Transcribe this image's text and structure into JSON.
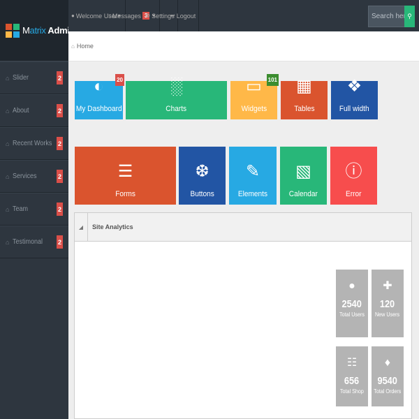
{
  "logo": {
    "part1": "M",
    "part2": "atrix",
    "part3": " Admin"
  },
  "sidebar": {
    "items": [
      {
        "label": "Slider",
        "badge": "2"
      },
      {
        "label": "About",
        "badge": "2"
      },
      {
        "label": "Recent Works",
        "badge": "2"
      },
      {
        "label": "Services",
        "badge": "2"
      },
      {
        "label": "Team",
        "badge": "2"
      },
      {
        "label": "Testimonal",
        "badge": "2"
      }
    ]
  },
  "topbar": {
    "welcome": "Welcome User",
    "messages": "Messages",
    "messages_count": "3",
    "settings": "Settings",
    "logout": "Logout",
    "search_placeholder": "Search here..."
  },
  "breadcrumb": {
    "home": "Home"
  },
  "tiles": [
    {
      "label": "My Dashboard",
      "icon": "dashboard-icon",
      "color": "#27a9e3",
      "badge": "20",
      "badge_color": "#da4f49"
    },
    {
      "label": "Charts",
      "icon": "bar-chart-icon",
      "color": "#28b779"
    },
    {
      "label": "Widgets",
      "icon": "inbox-icon",
      "color": "#ffb848",
      "badge": "101",
      "badge_color": "#3c8d2f"
    },
    {
      "label": "Tables",
      "icon": "table-icon",
      "color": "#da542e"
    },
    {
      "label": "Full width",
      "icon": "fullscreen-icon",
      "color": "#2255a4"
    },
    {
      "label": "Forms",
      "icon": "list-icon",
      "color": "#da542e"
    },
    {
      "label": "Buttons",
      "icon": "tint-icon",
      "color": "#2255a4"
    },
    {
      "label": "Elements",
      "icon": "pencil-icon",
      "color": "#27a9e3"
    },
    {
      "label": "Calendar",
      "icon": "calendar-icon",
      "color": "#28b779"
    },
    {
      "label": "Error",
      "icon": "info-icon",
      "color": "#f74d4d"
    }
  ],
  "analytics": {
    "title": "Site Analytics",
    "stats": [
      {
        "value": "2540",
        "label": "Total Users",
        "icon": "user-icon"
      },
      {
        "value": "120",
        "label": "New Users",
        "icon": "plus-icon"
      },
      {
        "value": "656",
        "label": "Total Shop",
        "icon": "cart-icon"
      },
      {
        "value": "9540",
        "label": "Total Orders",
        "icon": "tag-icon"
      }
    ]
  }
}
